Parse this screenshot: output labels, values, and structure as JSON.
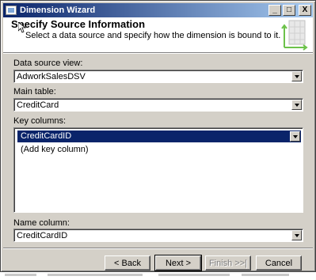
{
  "window": {
    "title": "Dimension Wizard"
  },
  "caption_buttons": {
    "minimize": "_",
    "maximize": "□",
    "close": "X"
  },
  "header": {
    "title": "Specify Source Information",
    "subtitle": "Select a data source and specify how the dimension is bound to it."
  },
  "fields": {
    "data_source_view": {
      "label": "Data source view:",
      "value": "AdworkSalesDSV"
    },
    "main_table": {
      "label": "Main table:",
      "value": "CreditCard"
    },
    "key_columns": {
      "label": "Key columns:",
      "selected": "CreditCardID",
      "add_item": "(Add key column)"
    },
    "name_column": {
      "label": "Name column:",
      "value": "CreditCardID"
    }
  },
  "buttons": {
    "back": "< Back",
    "next": "Next >",
    "finish": "Finish >>|",
    "cancel": "Cancel"
  }
}
